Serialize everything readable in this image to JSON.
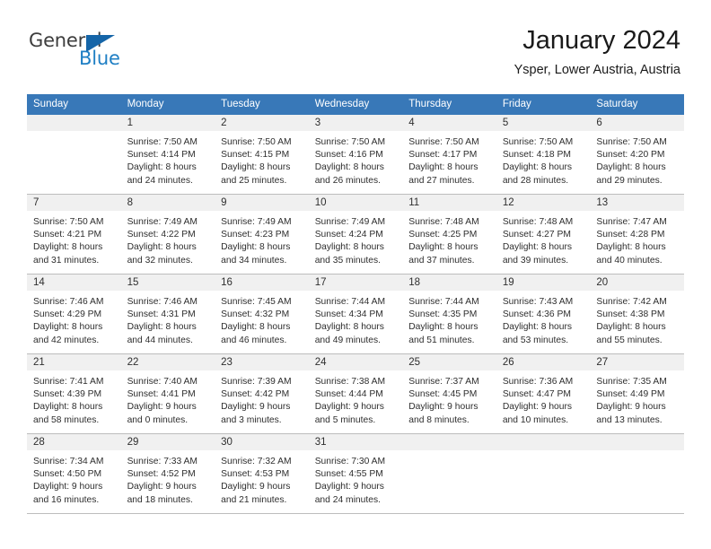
{
  "brand": {
    "name_part1": "General",
    "name_part2": "Blue",
    "triangle_color": "#1565a8",
    "blue_color": "#1f7fc4"
  },
  "header": {
    "title": "January 2024",
    "location": "Ysper, Lower Austria, Austria"
  },
  "theme": {
    "header_bg": "#3878b8",
    "daynum_bg": "#f0f0f0",
    "border": "#bdbdbd",
    "text": "#2e2e2e"
  },
  "weekdays": [
    "Sunday",
    "Monday",
    "Tuesday",
    "Wednesday",
    "Thursday",
    "Friday",
    "Saturday"
  ],
  "weeks": [
    [
      {
        "day": "",
        "sunrise": "",
        "sunset": "",
        "daylight1": "",
        "daylight2": ""
      },
      {
        "day": "1",
        "sunrise": "Sunrise: 7:50 AM",
        "sunset": "Sunset: 4:14 PM",
        "daylight1": "Daylight: 8 hours",
        "daylight2": "and 24 minutes."
      },
      {
        "day": "2",
        "sunrise": "Sunrise: 7:50 AM",
        "sunset": "Sunset: 4:15 PM",
        "daylight1": "Daylight: 8 hours",
        "daylight2": "and 25 minutes."
      },
      {
        "day": "3",
        "sunrise": "Sunrise: 7:50 AM",
        "sunset": "Sunset: 4:16 PM",
        "daylight1": "Daylight: 8 hours",
        "daylight2": "and 26 minutes."
      },
      {
        "day": "4",
        "sunrise": "Sunrise: 7:50 AM",
        "sunset": "Sunset: 4:17 PM",
        "daylight1": "Daylight: 8 hours",
        "daylight2": "and 27 minutes."
      },
      {
        "day": "5",
        "sunrise": "Sunrise: 7:50 AM",
        "sunset": "Sunset: 4:18 PM",
        "daylight1": "Daylight: 8 hours",
        "daylight2": "and 28 minutes."
      },
      {
        "day": "6",
        "sunrise": "Sunrise: 7:50 AM",
        "sunset": "Sunset: 4:20 PM",
        "daylight1": "Daylight: 8 hours",
        "daylight2": "and 29 minutes."
      }
    ],
    [
      {
        "day": "7",
        "sunrise": "Sunrise: 7:50 AM",
        "sunset": "Sunset: 4:21 PM",
        "daylight1": "Daylight: 8 hours",
        "daylight2": "and 31 minutes."
      },
      {
        "day": "8",
        "sunrise": "Sunrise: 7:49 AM",
        "sunset": "Sunset: 4:22 PM",
        "daylight1": "Daylight: 8 hours",
        "daylight2": "and 32 minutes."
      },
      {
        "day": "9",
        "sunrise": "Sunrise: 7:49 AM",
        "sunset": "Sunset: 4:23 PM",
        "daylight1": "Daylight: 8 hours",
        "daylight2": "and 34 minutes."
      },
      {
        "day": "10",
        "sunrise": "Sunrise: 7:49 AM",
        "sunset": "Sunset: 4:24 PM",
        "daylight1": "Daylight: 8 hours",
        "daylight2": "and 35 minutes."
      },
      {
        "day": "11",
        "sunrise": "Sunrise: 7:48 AM",
        "sunset": "Sunset: 4:25 PM",
        "daylight1": "Daylight: 8 hours",
        "daylight2": "and 37 minutes."
      },
      {
        "day": "12",
        "sunrise": "Sunrise: 7:48 AM",
        "sunset": "Sunset: 4:27 PM",
        "daylight1": "Daylight: 8 hours",
        "daylight2": "and 39 minutes."
      },
      {
        "day": "13",
        "sunrise": "Sunrise: 7:47 AM",
        "sunset": "Sunset: 4:28 PM",
        "daylight1": "Daylight: 8 hours",
        "daylight2": "and 40 minutes."
      }
    ],
    [
      {
        "day": "14",
        "sunrise": "Sunrise: 7:46 AM",
        "sunset": "Sunset: 4:29 PM",
        "daylight1": "Daylight: 8 hours",
        "daylight2": "and 42 minutes."
      },
      {
        "day": "15",
        "sunrise": "Sunrise: 7:46 AM",
        "sunset": "Sunset: 4:31 PM",
        "daylight1": "Daylight: 8 hours",
        "daylight2": "and 44 minutes."
      },
      {
        "day": "16",
        "sunrise": "Sunrise: 7:45 AM",
        "sunset": "Sunset: 4:32 PM",
        "daylight1": "Daylight: 8 hours",
        "daylight2": "and 46 minutes."
      },
      {
        "day": "17",
        "sunrise": "Sunrise: 7:44 AM",
        "sunset": "Sunset: 4:34 PM",
        "daylight1": "Daylight: 8 hours",
        "daylight2": "and 49 minutes."
      },
      {
        "day": "18",
        "sunrise": "Sunrise: 7:44 AM",
        "sunset": "Sunset: 4:35 PM",
        "daylight1": "Daylight: 8 hours",
        "daylight2": "and 51 minutes."
      },
      {
        "day": "19",
        "sunrise": "Sunrise: 7:43 AM",
        "sunset": "Sunset: 4:36 PM",
        "daylight1": "Daylight: 8 hours",
        "daylight2": "and 53 minutes."
      },
      {
        "day": "20",
        "sunrise": "Sunrise: 7:42 AM",
        "sunset": "Sunset: 4:38 PM",
        "daylight1": "Daylight: 8 hours",
        "daylight2": "and 55 minutes."
      }
    ],
    [
      {
        "day": "21",
        "sunrise": "Sunrise: 7:41 AM",
        "sunset": "Sunset: 4:39 PM",
        "daylight1": "Daylight: 8 hours",
        "daylight2": "and 58 minutes."
      },
      {
        "day": "22",
        "sunrise": "Sunrise: 7:40 AM",
        "sunset": "Sunset: 4:41 PM",
        "daylight1": "Daylight: 9 hours",
        "daylight2": "and 0 minutes."
      },
      {
        "day": "23",
        "sunrise": "Sunrise: 7:39 AM",
        "sunset": "Sunset: 4:42 PM",
        "daylight1": "Daylight: 9 hours",
        "daylight2": "and 3 minutes."
      },
      {
        "day": "24",
        "sunrise": "Sunrise: 7:38 AM",
        "sunset": "Sunset: 4:44 PM",
        "daylight1": "Daylight: 9 hours",
        "daylight2": "and 5 minutes."
      },
      {
        "day": "25",
        "sunrise": "Sunrise: 7:37 AM",
        "sunset": "Sunset: 4:45 PM",
        "daylight1": "Daylight: 9 hours",
        "daylight2": "and 8 minutes."
      },
      {
        "day": "26",
        "sunrise": "Sunrise: 7:36 AM",
        "sunset": "Sunset: 4:47 PM",
        "daylight1": "Daylight: 9 hours",
        "daylight2": "and 10 minutes."
      },
      {
        "day": "27",
        "sunrise": "Sunrise: 7:35 AM",
        "sunset": "Sunset: 4:49 PM",
        "daylight1": "Daylight: 9 hours",
        "daylight2": "and 13 minutes."
      }
    ],
    [
      {
        "day": "28",
        "sunrise": "Sunrise: 7:34 AM",
        "sunset": "Sunset: 4:50 PM",
        "daylight1": "Daylight: 9 hours",
        "daylight2": "and 16 minutes."
      },
      {
        "day": "29",
        "sunrise": "Sunrise: 7:33 AM",
        "sunset": "Sunset: 4:52 PM",
        "daylight1": "Daylight: 9 hours",
        "daylight2": "and 18 minutes."
      },
      {
        "day": "30",
        "sunrise": "Sunrise: 7:32 AM",
        "sunset": "Sunset: 4:53 PM",
        "daylight1": "Daylight: 9 hours",
        "daylight2": "and 21 minutes."
      },
      {
        "day": "31",
        "sunrise": "Sunrise: 7:30 AM",
        "sunset": "Sunset: 4:55 PM",
        "daylight1": "Daylight: 9 hours",
        "daylight2": "and 24 minutes."
      },
      {
        "day": "",
        "sunrise": "",
        "sunset": "",
        "daylight1": "",
        "daylight2": ""
      },
      {
        "day": "",
        "sunrise": "",
        "sunset": "",
        "daylight1": "",
        "daylight2": ""
      },
      {
        "day": "",
        "sunrise": "",
        "sunset": "",
        "daylight1": "",
        "daylight2": ""
      }
    ]
  ]
}
